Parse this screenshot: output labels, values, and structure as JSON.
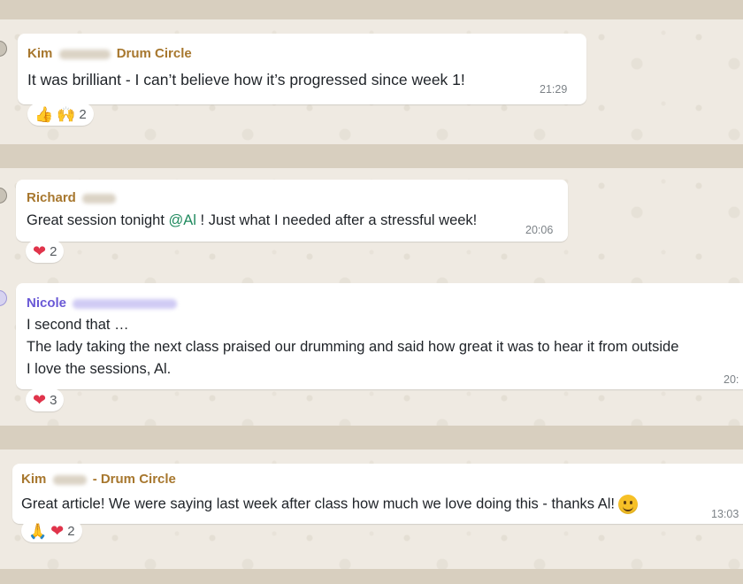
{
  "messages": [
    {
      "sender_first": "Kim",
      "sender_rest": "Drum Circle",
      "text": "It was brilliant - I can’t believe how it’s progressed since week 1!",
      "time": "21:29",
      "reactions": {
        "emojis": [
          "👍",
          "🙌"
        ],
        "count": "2"
      }
    },
    {
      "sender_first": "Richard",
      "sender_rest": "",
      "text_before": "Great session tonight ",
      "mention": "@Al",
      "text_after": " ! Just what I needed after a stressful week!",
      "time": "20:06",
      "reactions": {
        "emojis": [
          "❤"
        ],
        "count": "2"
      }
    },
    {
      "sender_first": "Nicole",
      "sender_rest": "",
      "lines": [
        "I second that …",
        "The lady taking the next class praised our drumming and said how great it was to hear it from outside",
        "I love the sessions, Al."
      ],
      "time": "20:",
      "reactions": {
        "emojis": [
          "❤"
        ],
        "count": "3"
      }
    },
    {
      "sender_first": "Kim",
      "sender_rest": "- Drum Circle",
      "text": "Great article! We were saying last week after class how much we love doing this - thanks Al!",
      "time": "13:03",
      "reactions": {
        "emojis": [
          "🙏",
          "❤"
        ],
        "count": "2"
      }
    }
  ],
  "colors": {
    "sender_gold": "#a7772e",
    "sender_purple": "#6a59d6",
    "mention_green": "#1f8a5e",
    "heart_red": "#e0344b",
    "bubble": "#ffffff",
    "wallpaper": "#efeae2",
    "separator": "#d8cfbf"
  }
}
